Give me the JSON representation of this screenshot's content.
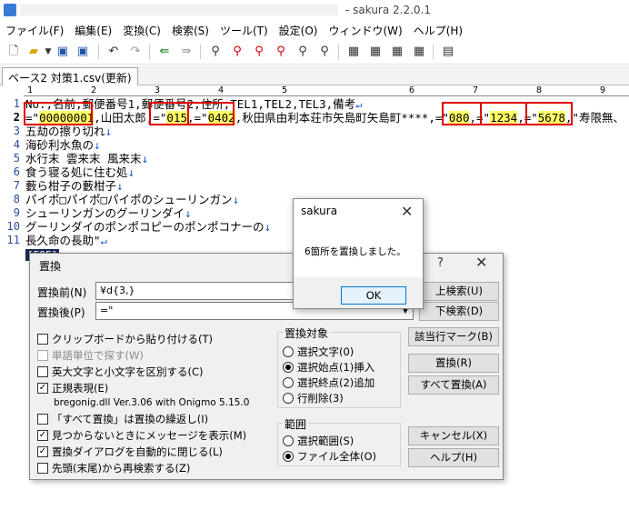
{
  "window": {
    "title": "- sakura 2.2.0.1"
  },
  "menu": [
    "ファイル(F)",
    "編集(E)",
    "変換(C)",
    "検索(S)",
    "ツール(T)",
    "設定(O)",
    "ウィンドウ(W)",
    "ヘルプ(H)"
  ],
  "toolbar_icons": [
    "new-file-icon",
    "open-folder-icon",
    "save-icon",
    "save-all-icon",
    "undo-icon",
    "redo-icon",
    "jump-back-icon",
    "jump-forward-icon",
    "find-icon",
    "find-next-icon",
    "find-prev-icon",
    "bookmark-icon",
    "grep-icon",
    "settings-icon",
    "font-icon",
    "print-icon"
  ],
  "tab": {
    "label": "ベース2 対策1.csv(更新)"
  },
  "ruler": [
    "1",
    "2",
    "3",
    "4",
    "5",
    "6",
    "7",
    "8",
    "9"
  ],
  "editor": {
    "lines": [
      {
        "num": "1",
        "text": "No.,名前,郵便番号1,郵便番号2,住所,TEL1,TEL2,TEL3,備考"
      },
      {
        "num": "2",
        "parts": [
          "=\"",
          "00000001",
          ",山田太郎,",
          "=\"",
          "015",
          ",",
          "=\"",
          "0402",
          ",秋田県由利本荘市矢島町矢島町****,",
          "=\"",
          "080",
          ",",
          "=\"",
          "1234",
          ",",
          "=\"",
          "5678",
          ",\"寿限無、"
        ]
      },
      {
        "num": "3",
        "text": "五劫の擦り切れ"
      },
      {
        "num": "4",
        "text": "海砂利水魚の"
      },
      {
        "num": "5",
        "text": "水行末 雲来末 風来末"
      },
      {
        "num": "6",
        "text": "食う寝る処に住む処"
      },
      {
        "num": "7",
        "text": "藪ら柑子の藪柑子"
      },
      {
        "num": "8",
        "text": "パイポ□パイポ□パイポのシューリンガン"
      },
      {
        "num": "9",
        "text": "シューリンガンのグーリンダイ"
      },
      {
        "num": "10",
        "text": "グーリンダイのポンポコピーのポンポコナーの"
      },
      {
        "num": "11",
        "text": "長久命の長助\""
      }
    ],
    "eof": "[EOF]",
    "line_end_mark": "↓",
    "last_line_end_mark": "↵"
  },
  "replace_dialog": {
    "title": "置換",
    "help": "?",
    "find_label": "置換前(N)",
    "find_value": "¥d{3,}",
    "replace_label": "置換後(P)",
    "replace_value": "=\"",
    "options": [
      {
        "label": "クリップボードから貼り付ける(T)",
        "checked": false,
        "disabled": false
      },
      {
        "label": "単語単位で探す(W)",
        "checked": false,
        "disabled": true
      },
      {
        "label": "英大文字と小文字を区別する(C)",
        "checked": false,
        "disabled": false
      },
      {
        "label": "正規表現(E)",
        "checked": true,
        "disabled": false
      }
    ],
    "regex_lib": "bregonig.dll Ver.3.06 with Onigmo 5.15.0",
    "options2": [
      {
        "label": "「すべて置換」は置換の繰返し(I)",
        "checked": false
      },
      {
        "label": "見つからないときにメッセージを表示(M)",
        "checked": true
      },
      {
        "label": "置換ダイアログを自動的に閉じる(L)",
        "checked": true
      },
      {
        "label": "先頭(末尾)から再検索する(Z)",
        "checked": false
      }
    ],
    "target_group": {
      "title": "置換対象",
      "items": [
        {
          "label": "選択文字(0)",
          "selected": false
        },
        {
          "label": "選択始点(1)挿入",
          "selected": true
        },
        {
          "label": "選択終点(2)追加",
          "selected": false
        },
        {
          "label": "行削除(3)",
          "selected": false
        }
      ]
    },
    "scope_group": {
      "title": "範囲",
      "items": [
        {
          "label": "選択範囲(S)",
          "selected": false
        },
        {
          "label": "ファイル全体(O)",
          "selected": true
        }
      ]
    },
    "buttons": {
      "up": "上検索(U)",
      "down": "下検索(D)",
      "mark": "該当行マーク(B)",
      "replace": "置換(R)",
      "replace_all": "すべて置換(A)",
      "cancel": "キャンセル(X)",
      "help": "ヘルプ(H)"
    }
  },
  "message_box": {
    "title": "sakura",
    "text": "6箇所を置換しました。",
    "ok": "OK"
  }
}
